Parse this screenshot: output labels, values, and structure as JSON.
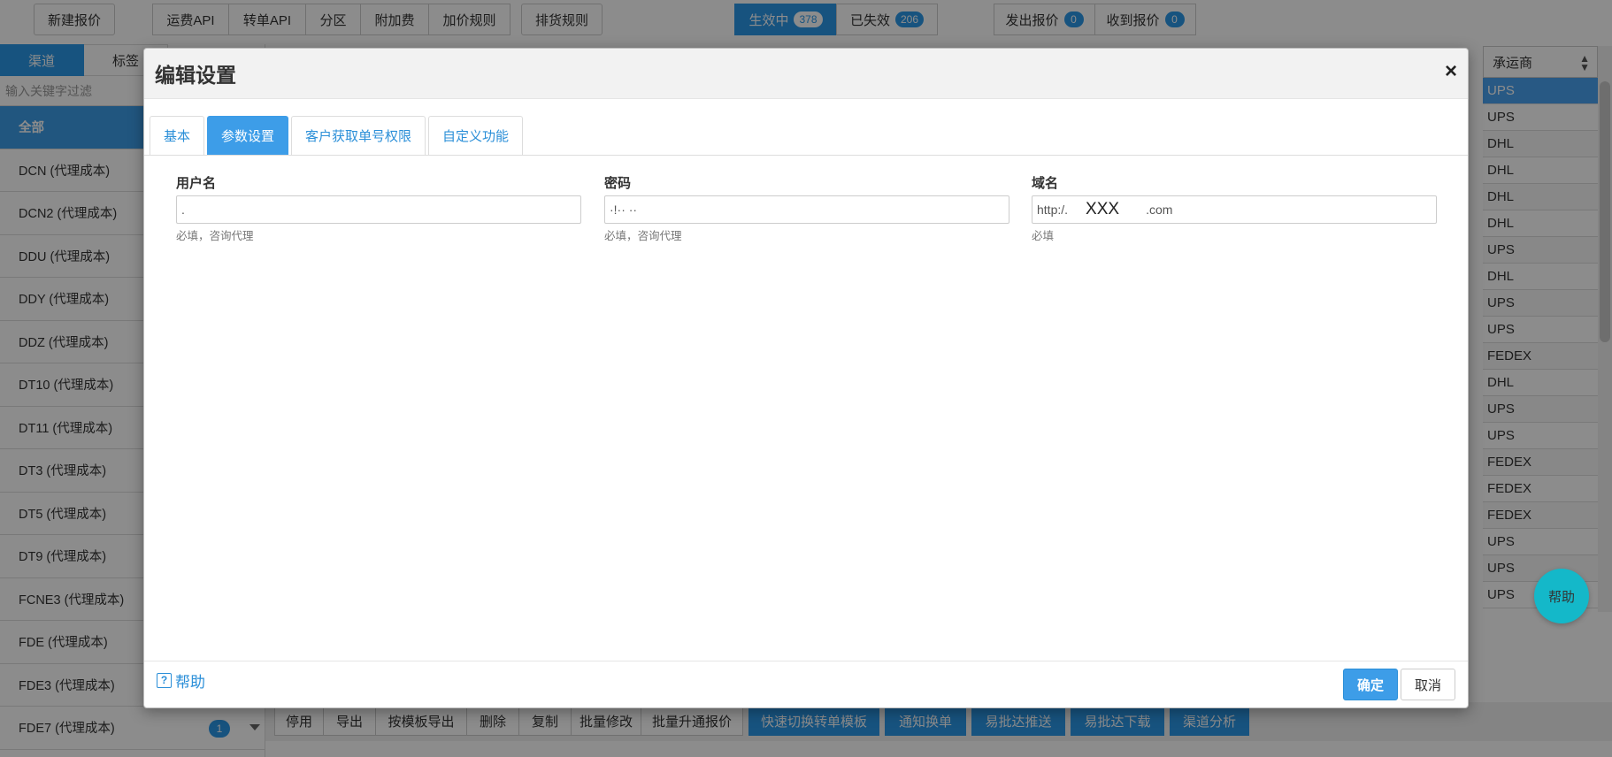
{
  "topbar": {
    "new_quote": "新建报价",
    "group1": [
      "运费API",
      "转单API",
      "分区",
      "附加费",
      "加价规则"
    ],
    "dispatch_rules": "排货规则",
    "status": [
      {
        "label": "生效中",
        "count": "378"
      },
      {
        "label": "已失效",
        "count": "206"
      }
    ],
    "quotes": [
      {
        "label": "发出报价",
        "count": "0"
      },
      {
        "label": "收到报价",
        "count": "0"
      }
    ]
  },
  "left_panel": {
    "tabs": [
      "渠道",
      "标签"
    ],
    "filter_placeholder": "输入关键字过滤",
    "items": [
      "全部",
      "DCN (代理成本)",
      "DCN2 (代理成本)",
      "DDU (代理成本)",
      "DDY (代理成本)",
      "DDZ (代理成本)",
      "DT10 (代理成本)",
      "DT11 (代理成本)",
      "DT3 (代理成本)",
      "DT5 (代理成本)",
      "DT9 (代理成本)",
      "FCNE3 (代理成本)",
      "FDE (代理成本)",
      "FDE3 (代理成本)",
      "FDE7 (代理成本)"
    ],
    "last_item_count": "1"
  },
  "right_column": {
    "header": "承运商",
    "carriers": [
      "UPS",
      "UPS",
      "DHL",
      "DHL",
      "DHL",
      "DHL",
      "UPS",
      "DHL",
      "UPS",
      "UPS",
      "FEDEX",
      "DHL",
      "UPS",
      "UPS",
      "FEDEX",
      "FEDEX",
      "FEDEX",
      "UPS",
      "UPS",
      "UPS"
    ]
  },
  "bottom_bar": {
    "buttons": [
      "停用",
      "导出",
      "按模板导出",
      "删除",
      "复制",
      "批量修改",
      "批量升通报价"
    ],
    "blue_buttons": [
      "快速切换转单模板",
      "通知换单",
      "易批达推送",
      "易批达下载",
      "渠道分析"
    ]
  },
  "help_fab": "帮助",
  "modal": {
    "title": "编辑设置",
    "close": "×",
    "tabs": [
      "基本",
      "参数设置",
      "客户获取单号权限",
      "自定义功能"
    ],
    "fields": {
      "username": {
        "label": "用户名",
        "value": ".",
        "help": "必填，咨询代理"
      },
      "password": {
        "label": "密码",
        "value": "·!·· ··",
        "help": "必填，咨询代理"
      },
      "domain": {
        "label": "域名",
        "value_prefix": "http:/.",
        "value_mid": "XXX",
        "value_suffix": ".com",
        "help": "必填"
      }
    },
    "footer": {
      "help": "帮助",
      "ok": "确定",
      "cancel": "取消"
    }
  }
}
